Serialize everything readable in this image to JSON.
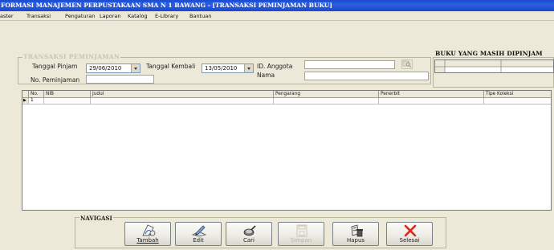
{
  "window": {
    "title": "FORMASI MANAJEMEN PERPUSTAKAAN SMA N 1 BAWANG - [TRANSAKSI PEMINJAMAN BUKU]"
  },
  "menubar": {
    "items": [
      "aster",
      "Transaksi",
      "Pengaturan",
      "Laporan",
      "Katalog",
      "E-Library",
      "Bantuan"
    ]
  },
  "transaksi": {
    "legend": "TRANSAKSI PEMINJAMAN",
    "tanggal_pinjam_label": "Tanggal Pinjam",
    "tanggal_pinjam_value": "29/06/2010",
    "tanggal_kembali_label": "Tanggal Kembali",
    "tanggal_kembali_value": "13/05/2010",
    "id_anggota_label": "ID. Anggota",
    "id_anggota_value": "",
    "nama_label": "Nama",
    "nama_value": "",
    "no_peminjaman_label": "No. Peminjaman",
    "no_peminjaman_value": ""
  },
  "pinjaman_panel": {
    "title": "BUKU YANG MASIH DIPINJAM"
  },
  "grid": {
    "columns": [
      "No.",
      "NIB",
      "Judul",
      "Pengarang",
      "Penerbit",
      "Tipe Koleksi"
    ],
    "rows": [
      {
        "no": "1",
        "nib": "",
        "judul": "",
        "pengarang": "",
        "penerbit": "",
        "tipe": ""
      }
    ],
    "row_indicator": "▶"
  },
  "navigasi": {
    "legend": "NAVIGASI",
    "buttons": [
      {
        "label": "Tambah",
        "icon": "add-record-icon",
        "enabled": true
      },
      {
        "label": "Edit",
        "icon": "edit-pencil-icon",
        "enabled": true
      },
      {
        "label": "Cari",
        "icon": "search-magnifier-icon",
        "enabled": true
      },
      {
        "label": "Simpan",
        "icon": "save-disk-icon",
        "enabled": false
      },
      {
        "label": "Hapus",
        "icon": "delete-trash-icon",
        "enabled": true
      },
      {
        "label": "Selesai",
        "icon": "close-x-icon",
        "enabled": true
      }
    ]
  },
  "colors": {
    "title_bar": "#2c5fe3",
    "form_background": "#ece9d8",
    "close_icon": "#e0271d",
    "legend_faded": "#c9c3bb"
  }
}
